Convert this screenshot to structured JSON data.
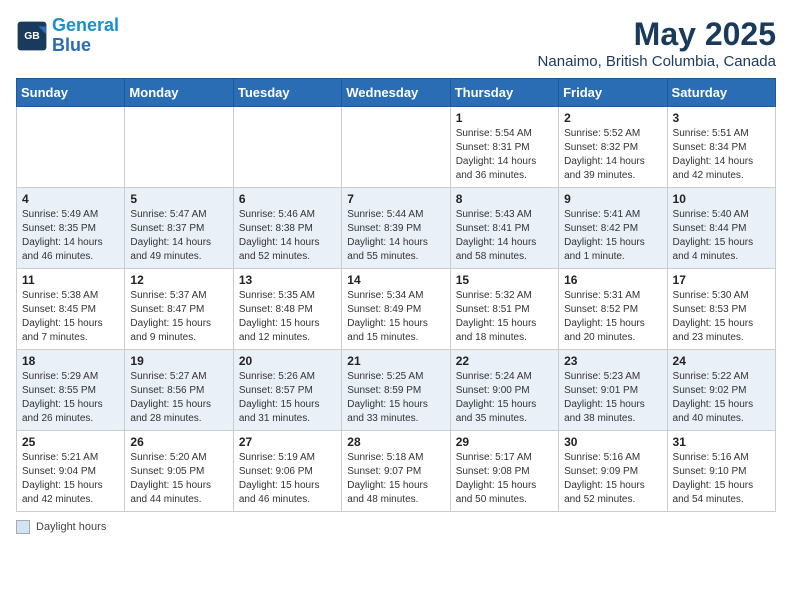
{
  "header": {
    "logo_line1": "General",
    "logo_line2": "Blue",
    "month": "May 2025",
    "location": "Nanaimo, British Columbia, Canada"
  },
  "days_of_week": [
    "Sunday",
    "Monday",
    "Tuesday",
    "Wednesday",
    "Thursday",
    "Friday",
    "Saturday"
  ],
  "footer": {
    "note": "Daylight hours"
  },
  "weeks": [
    {
      "days": [
        {
          "num": "",
          "info": ""
        },
        {
          "num": "",
          "info": ""
        },
        {
          "num": "",
          "info": ""
        },
        {
          "num": "",
          "info": ""
        },
        {
          "num": "1",
          "info": "Sunrise: 5:54 AM\nSunset: 8:31 PM\nDaylight: 14 hours\nand 36 minutes."
        },
        {
          "num": "2",
          "info": "Sunrise: 5:52 AM\nSunset: 8:32 PM\nDaylight: 14 hours\nand 39 minutes."
        },
        {
          "num": "3",
          "info": "Sunrise: 5:51 AM\nSunset: 8:34 PM\nDaylight: 14 hours\nand 42 minutes."
        }
      ]
    },
    {
      "days": [
        {
          "num": "4",
          "info": "Sunrise: 5:49 AM\nSunset: 8:35 PM\nDaylight: 14 hours\nand 46 minutes."
        },
        {
          "num": "5",
          "info": "Sunrise: 5:47 AM\nSunset: 8:37 PM\nDaylight: 14 hours\nand 49 minutes."
        },
        {
          "num": "6",
          "info": "Sunrise: 5:46 AM\nSunset: 8:38 PM\nDaylight: 14 hours\nand 52 minutes."
        },
        {
          "num": "7",
          "info": "Sunrise: 5:44 AM\nSunset: 8:39 PM\nDaylight: 14 hours\nand 55 minutes."
        },
        {
          "num": "8",
          "info": "Sunrise: 5:43 AM\nSunset: 8:41 PM\nDaylight: 14 hours\nand 58 minutes."
        },
        {
          "num": "9",
          "info": "Sunrise: 5:41 AM\nSunset: 8:42 PM\nDaylight: 15 hours\nand 1 minute."
        },
        {
          "num": "10",
          "info": "Sunrise: 5:40 AM\nSunset: 8:44 PM\nDaylight: 15 hours\nand 4 minutes."
        }
      ]
    },
    {
      "days": [
        {
          "num": "11",
          "info": "Sunrise: 5:38 AM\nSunset: 8:45 PM\nDaylight: 15 hours\nand 7 minutes."
        },
        {
          "num": "12",
          "info": "Sunrise: 5:37 AM\nSunset: 8:47 PM\nDaylight: 15 hours\nand 9 minutes."
        },
        {
          "num": "13",
          "info": "Sunrise: 5:35 AM\nSunset: 8:48 PM\nDaylight: 15 hours\nand 12 minutes."
        },
        {
          "num": "14",
          "info": "Sunrise: 5:34 AM\nSunset: 8:49 PM\nDaylight: 15 hours\nand 15 minutes."
        },
        {
          "num": "15",
          "info": "Sunrise: 5:32 AM\nSunset: 8:51 PM\nDaylight: 15 hours\nand 18 minutes."
        },
        {
          "num": "16",
          "info": "Sunrise: 5:31 AM\nSunset: 8:52 PM\nDaylight: 15 hours\nand 20 minutes."
        },
        {
          "num": "17",
          "info": "Sunrise: 5:30 AM\nSunset: 8:53 PM\nDaylight: 15 hours\nand 23 minutes."
        }
      ]
    },
    {
      "days": [
        {
          "num": "18",
          "info": "Sunrise: 5:29 AM\nSunset: 8:55 PM\nDaylight: 15 hours\nand 26 minutes."
        },
        {
          "num": "19",
          "info": "Sunrise: 5:27 AM\nSunset: 8:56 PM\nDaylight: 15 hours\nand 28 minutes."
        },
        {
          "num": "20",
          "info": "Sunrise: 5:26 AM\nSunset: 8:57 PM\nDaylight: 15 hours\nand 31 minutes."
        },
        {
          "num": "21",
          "info": "Sunrise: 5:25 AM\nSunset: 8:59 PM\nDaylight: 15 hours\nand 33 minutes."
        },
        {
          "num": "22",
          "info": "Sunrise: 5:24 AM\nSunset: 9:00 PM\nDaylight: 15 hours\nand 35 minutes."
        },
        {
          "num": "23",
          "info": "Sunrise: 5:23 AM\nSunset: 9:01 PM\nDaylight: 15 hours\nand 38 minutes."
        },
        {
          "num": "24",
          "info": "Sunrise: 5:22 AM\nSunset: 9:02 PM\nDaylight: 15 hours\nand 40 minutes."
        }
      ]
    },
    {
      "days": [
        {
          "num": "25",
          "info": "Sunrise: 5:21 AM\nSunset: 9:04 PM\nDaylight: 15 hours\nand 42 minutes."
        },
        {
          "num": "26",
          "info": "Sunrise: 5:20 AM\nSunset: 9:05 PM\nDaylight: 15 hours\nand 44 minutes."
        },
        {
          "num": "27",
          "info": "Sunrise: 5:19 AM\nSunset: 9:06 PM\nDaylight: 15 hours\nand 46 minutes."
        },
        {
          "num": "28",
          "info": "Sunrise: 5:18 AM\nSunset: 9:07 PM\nDaylight: 15 hours\nand 48 minutes."
        },
        {
          "num": "29",
          "info": "Sunrise: 5:17 AM\nSunset: 9:08 PM\nDaylight: 15 hours\nand 50 minutes."
        },
        {
          "num": "30",
          "info": "Sunrise: 5:16 AM\nSunset: 9:09 PM\nDaylight: 15 hours\nand 52 minutes."
        },
        {
          "num": "31",
          "info": "Sunrise: 5:16 AM\nSunset: 9:10 PM\nDaylight: 15 hours\nand 54 minutes."
        }
      ]
    }
  ]
}
